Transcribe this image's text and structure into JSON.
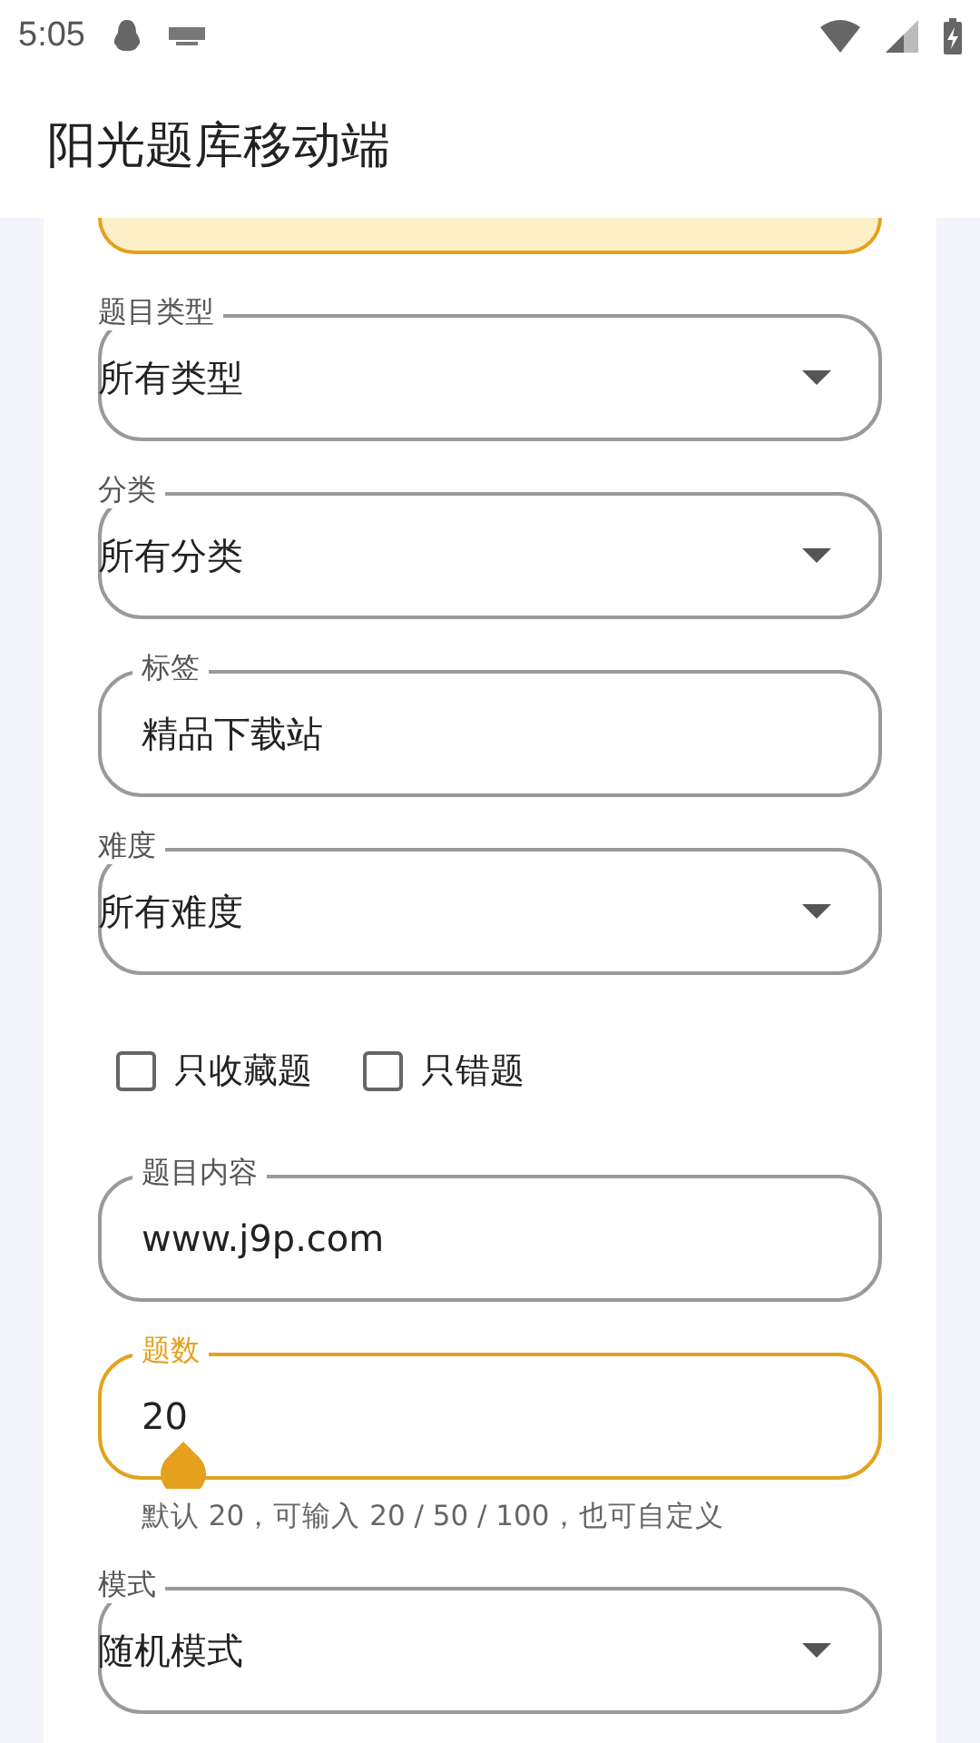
{
  "status_bar": {
    "time": "5:05"
  },
  "app_bar": {
    "title": "阳光题库移动端"
  },
  "fields": [
    {
      "kind": "partial"
    },
    {
      "kind": "dropdown",
      "label": "题目类型",
      "value": "所有类型",
      "focused": false
    },
    {
      "kind": "dropdown",
      "label": "分类",
      "value": "所有分类",
      "focused": false
    },
    {
      "kind": "text",
      "label": "标签",
      "value": "精品下载站",
      "focused": false
    },
    {
      "kind": "dropdown",
      "label": "难度",
      "value": "所有难度",
      "focused": false
    },
    {
      "kind": "checkboxes",
      "options": [
        {
          "label": "只收藏题",
          "checked": false
        },
        {
          "label": "只错题",
          "checked": false
        }
      ]
    },
    {
      "kind": "text",
      "label": "题目内容",
      "value": "www.j9p.com",
      "focused": false
    },
    {
      "kind": "text",
      "label": "题数",
      "value": "20",
      "focused": true,
      "helper": "默认 20，可输入 20 / 50 / 100，也可自定义"
    },
    {
      "kind": "dropdown",
      "label": "模式",
      "value": "随机模式",
      "focused": false
    }
  ]
}
